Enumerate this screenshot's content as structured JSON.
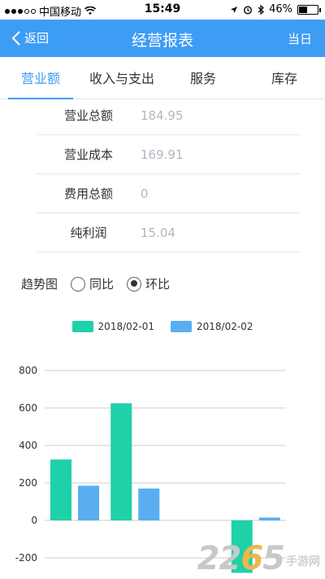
{
  "status_bar": {
    "carrier": "中国移动",
    "time": "15:49",
    "battery": "46%",
    "battery_level": 0.46
  },
  "nav": {
    "back_label": "返回",
    "title": "经营报表",
    "right_label": "当日"
  },
  "tabs": [
    {
      "label": "营业额",
      "active": true
    },
    {
      "label": "收入与支出",
      "active": false
    },
    {
      "label": "服务",
      "active": false
    },
    {
      "label": "库存",
      "active": false
    }
  ],
  "summary": [
    {
      "label": "营业总额",
      "value": "184.95"
    },
    {
      "label": "营业成本",
      "value": "169.91"
    },
    {
      "label": "费用总额",
      "value": "0"
    },
    {
      "label": "纯利润",
      "value": "15.04"
    }
  ],
  "trend": {
    "label": "趋势图",
    "options": [
      {
        "label": "同比",
        "checked": false
      },
      {
        "label": "环比",
        "checked": true
      }
    ]
  },
  "colors": {
    "accent": "#3d9df5",
    "series1": "#1fd1a9",
    "series2": "#5aaef0"
  },
  "watermark": {
    "number": "2265",
    "site": "手游网"
  },
  "chart_data": {
    "type": "bar",
    "categories": [
      "",
      "",
      "",
      ""
    ],
    "series": [
      {
        "name": "2018/02-01",
        "values": [
          325,
          625,
          0,
          -280
        ]
      },
      {
        "name": "2018/02-02",
        "values": [
          185,
          170,
          0,
          15
        ]
      }
    ],
    "yticks": [
      "800",
      "600",
      "400",
      "200",
      "0",
      "-200"
    ],
    "ylim": [
      -240,
      800
    ],
    "grid": true,
    "legend": "top-center"
  }
}
